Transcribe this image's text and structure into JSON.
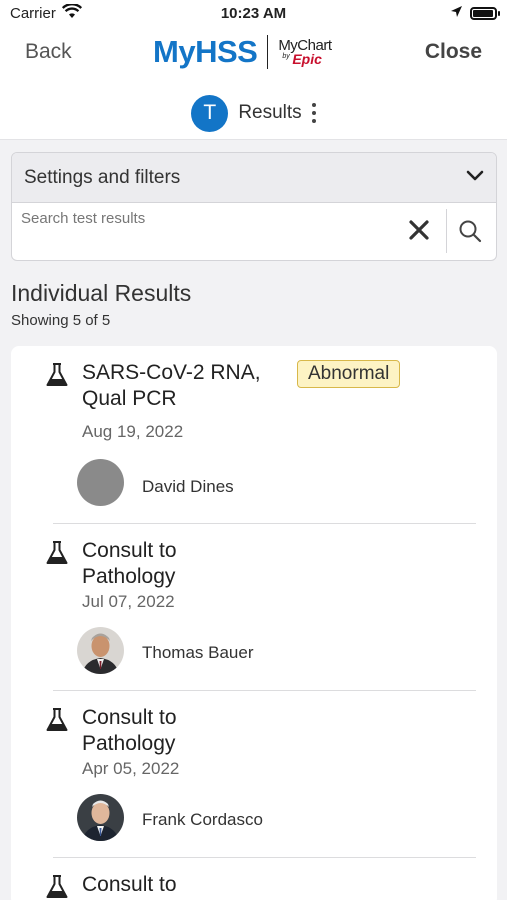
{
  "status_bar": {
    "carrier": "Carrier",
    "time": "10:23 AM",
    "battery_level": 0.95
  },
  "nav": {
    "back": "Back",
    "close": "Close",
    "logo": {
      "brand": "MyHSS",
      "partner": "MyChart",
      "partner_by": "by",
      "partner_epic": "Epic"
    },
    "avatar_initial": "T",
    "title": "Results"
  },
  "filters": {
    "label": "Settings and filters",
    "search_placeholder": "Search test results"
  },
  "results_section": {
    "title": "Individual Results",
    "count": "Showing 5 of 5"
  },
  "results": [
    {
      "name": "SARS-CoV-2 RNA, Qual PCR",
      "badge": "Abnormal",
      "date": "Aug 19, 2022",
      "provider": "David Dines",
      "avatar": "gray-placeholder"
    },
    {
      "name": "Consult to Pathology",
      "date": "Jul 07, 2022",
      "provider": "Thomas Bauer",
      "avatar": "photo"
    },
    {
      "name": "Consult to Pathology",
      "date": "Apr 05, 2022",
      "provider": "Frank Cordasco",
      "avatar": "photo"
    },
    {
      "name": "Consult to"
    }
  ],
  "colors": {
    "brand_blue": "#1375c7",
    "epic_red": "#c8102e",
    "badge_bg": "#fdf3c4",
    "badge_border": "#d8b84a"
  }
}
